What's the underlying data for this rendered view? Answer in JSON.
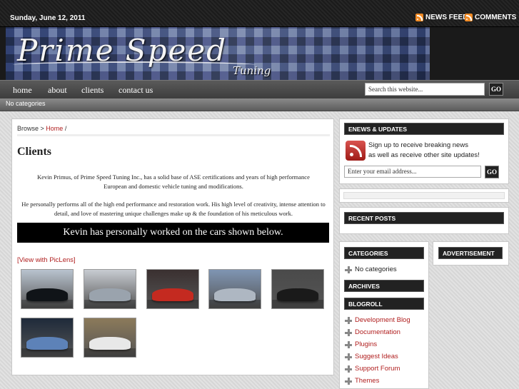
{
  "topbar": {
    "date": "Sunday, June 12, 2011",
    "news_feed": "NEWS FEED",
    "comments": "COMMENTS",
    "feed_icon": "rss-icon"
  },
  "header": {
    "logo_text": "Prime Speed",
    "logo_sub": "Tuning"
  },
  "nav": {
    "items": [
      "home",
      "about",
      "clients",
      "contact us"
    ],
    "search_placeholder": "Search this website...",
    "go_label": "GO"
  },
  "subnav": {
    "text": "No categories"
  },
  "content": {
    "breadcrumb_prefix": "Browse >",
    "breadcrumb_home": "Home",
    "breadcrumb_sep": "/",
    "title": "Clients",
    "para1": "Kevin Primus, of Prime Speed Tuning Inc., has a solid base of ASE certifications and years of high performance European and domestic vehicle tuning and modifications.",
    "para2": "He personally performs all of the high end performance and restoration work. His high level of creativity, intense attention to detail, and love of mastering unique challenges make up & the foundation of his meticulous work.",
    "banner": "Kevin has personally worked on the cars shown below.",
    "piclens": "[View with PicLens]",
    "thumbnails": [
      {
        "bg": "#b9c3cf",
        "car": "#101418"
      },
      {
        "bg": "#c8ccd2",
        "car": "#9aa3ad"
      },
      {
        "bg": "#3a3030",
        "car": "#c42a20"
      },
      {
        "bg": "#7f95b3",
        "car": "#aeb7c2"
      },
      {
        "bg": "#4a4a4a",
        "car": "#1a1a1a"
      },
      {
        "bg": "#1e2a3a",
        "car": "#5d82b8"
      },
      {
        "bg": "#8c7a5a",
        "car": "#e8e8e8"
      }
    ]
  },
  "sidebar": {
    "enews_title": "ENEWS & UPDATES",
    "enews_line1": "Sign up to receive breaking news",
    "enews_line2": "as well as receive other site updates!",
    "email_placeholder": "Enter your email address...",
    "go_label": "GO",
    "recent_posts_title": "RECENT POSTS",
    "categories_title": "CATEGORIES",
    "advertisement_title": "ADVERTISEMENT",
    "no_categories": "No categories",
    "archives_title": "ARCHIVES",
    "blogroll_title": "BLOGROLL",
    "blogroll": [
      "Development Blog",
      "Documentation",
      "Plugins",
      "Suggest Ideas",
      "Support Forum",
      "Themes"
    ]
  },
  "colors": {
    "link_red": "#b01e1e",
    "rss_orange": "#f08a24",
    "header_dark": "#222222"
  }
}
